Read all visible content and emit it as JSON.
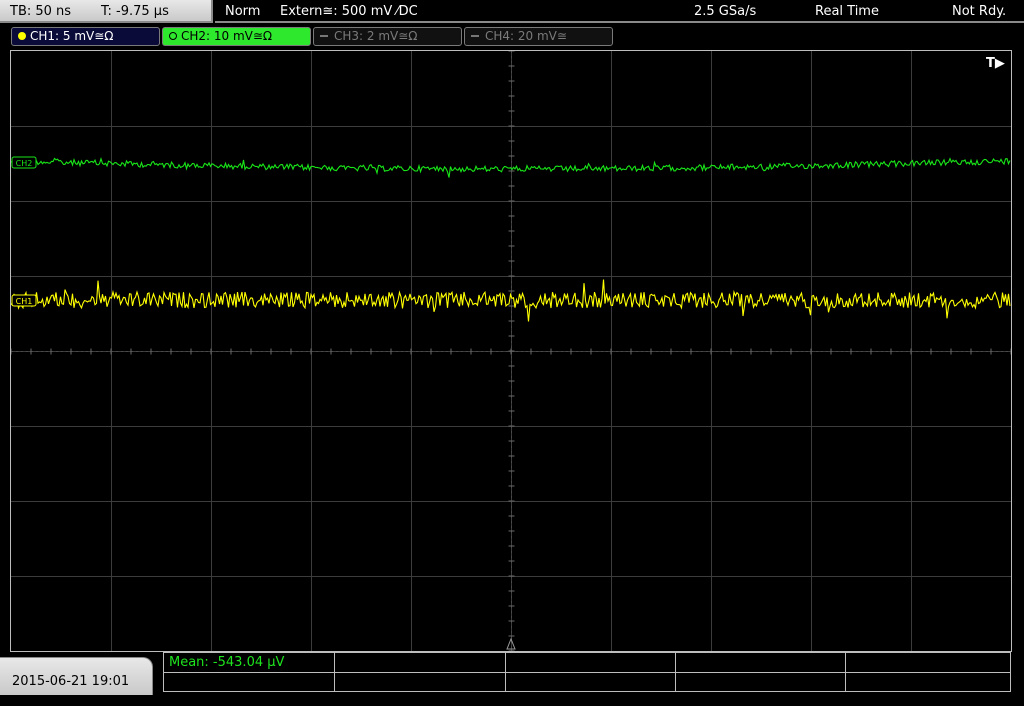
{
  "status": {
    "timebase": "TB: 50 ns",
    "trigger_time": "T: -9.75 µs",
    "mode": "Norm",
    "trigger_source": "Extern≅: 500 mV ⁄DC",
    "sample_rate": "2.5 GSa/s",
    "acq_mode": "Real Time",
    "trigger_state": "Not Rdy."
  },
  "channels": [
    {
      "label": "CH1: 5 mV≅Ω",
      "active": true,
      "color": "#ffff00",
      "selected": false
    },
    {
      "label": "CH2: 10 mV≅Ω",
      "active": true,
      "color": "#19e619",
      "selected": true
    },
    {
      "label": "CH3: 2 mV≅Ω",
      "active": false,
      "color": "#777777",
      "selected": false
    },
    {
      "label": "CH4: 20 mV≅",
      "active": false,
      "color": "#777777",
      "selected": false
    }
  ],
  "screen": {
    "trigger_pos_marker": "T▶",
    "ch1_marker": "CH1",
    "ch2_marker": "CH2"
  },
  "measurement": {
    "mean": "Mean: -543.04 µV"
  },
  "datetime": "2015-06-21 19:01"
}
